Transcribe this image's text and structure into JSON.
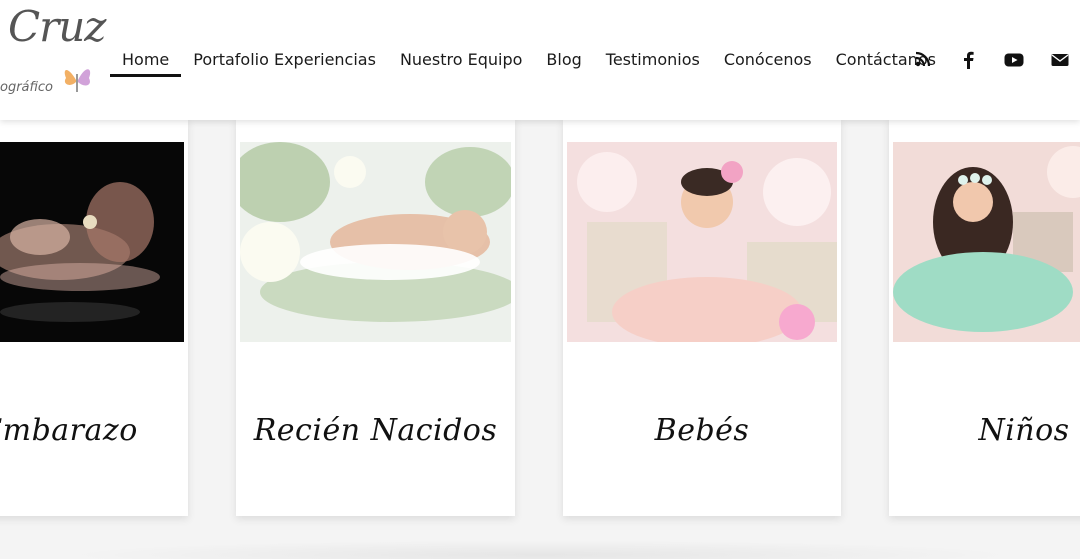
{
  "logo": {
    "script": "Cruz",
    "subtitle": "ográfico"
  },
  "nav": {
    "items": [
      {
        "label": "Home",
        "active": true
      },
      {
        "label": "Portafolio Experiencias",
        "active": false
      },
      {
        "label": "Nuestro Equipo",
        "active": false
      },
      {
        "label": "Blog",
        "active": false
      },
      {
        "label": "Testimonios",
        "active": false
      },
      {
        "label": "Conócenos",
        "active": false
      },
      {
        "label": "Contáctanos",
        "active": false
      }
    ],
    "icons": [
      "blog-icon",
      "facebook-icon",
      "youtube-icon",
      "email-icon"
    ]
  },
  "cards": [
    {
      "title": "Embarazo",
      "photo": "pregnancy-photo"
    },
    {
      "title": "Recién Nacidos",
      "photo": "newborn-photo"
    },
    {
      "title": "Bebés",
      "photo": "baby-photo"
    },
    {
      "title": "Niños",
      "photo": "child-photo"
    }
  ],
  "colors": {
    "accent": "#111111",
    "card_bg": "#ffffff",
    "page_bg": "#f4f4f4"
  }
}
